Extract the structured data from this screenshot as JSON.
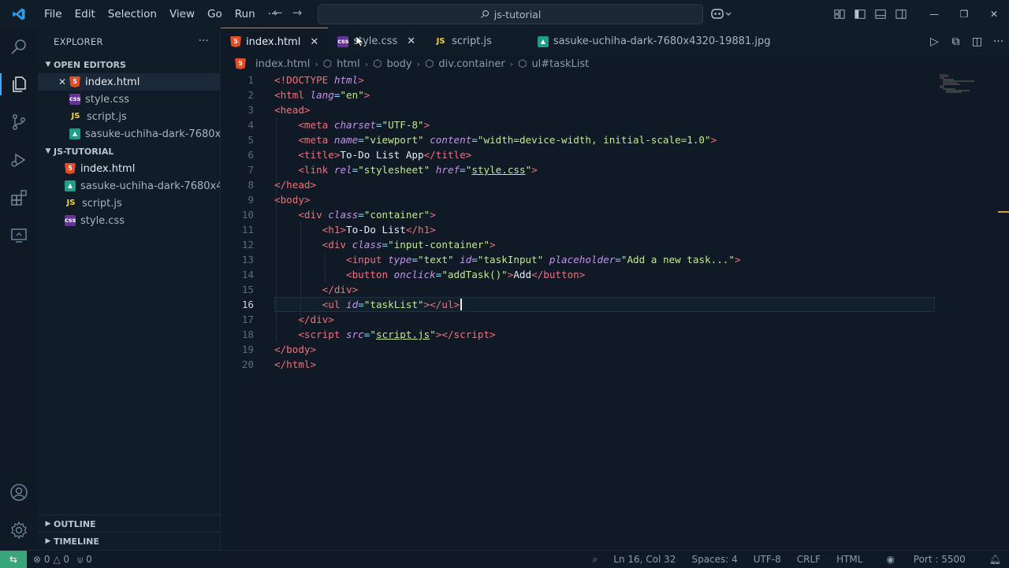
{
  "titlebar": {
    "menu": [
      "File",
      "Edit",
      "Selection",
      "View",
      "Go",
      "Run",
      "···"
    ],
    "search_text": "js-tutorial"
  },
  "sidebar": {
    "title": "EXPLORER",
    "open_editors": {
      "label": "OPEN EDITORS",
      "items": [
        "index.html",
        "style.css",
        "script.js",
        "sasuke-uchiha-dark-7680x..."
      ]
    },
    "folder": {
      "label": "JS-TUTORIAL",
      "items": [
        "index.html",
        "sasuke-uchiha-dark-7680x43...",
        "script.js",
        "style.css"
      ]
    },
    "outline_label": "OUTLINE",
    "timeline_label": "TIMELINE"
  },
  "tabs": [
    "index.html",
    "style.css",
    "script.js",
    "sasuke-uchiha-dark-7680x4320-19881.jpg"
  ],
  "breadcrumb": [
    "index.html",
    "html",
    "body",
    "div.container",
    "ul#taskList"
  ],
  "editor": {
    "line_numbers": [
      "1",
      "2",
      "3",
      "4",
      "5",
      "6",
      "7",
      "8",
      "9",
      "10",
      "11",
      "12",
      "13",
      "14",
      "15",
      "16",
      "17",
      "18",
      "19",
      "20"
    ]
  },
  "status": {
    "errors": "0",
    "warnings": "0",
    "ports": "0",
    "position": "Ln 16, Col 32",
    "spaces": "Spaces: 4",
    "encoding": "UTF-8",
    "eol": "CRLF",
    "language": "HTML",
    "port": "Port : 5500"
  },
  "colors": {
    "accent": "#3fa7ff",
    "remote_badge": "#3aa57a",
    "tag": "#f07178",
    "attribute": "#c792ea",
    "string": "#c3e88d"
  }
}
